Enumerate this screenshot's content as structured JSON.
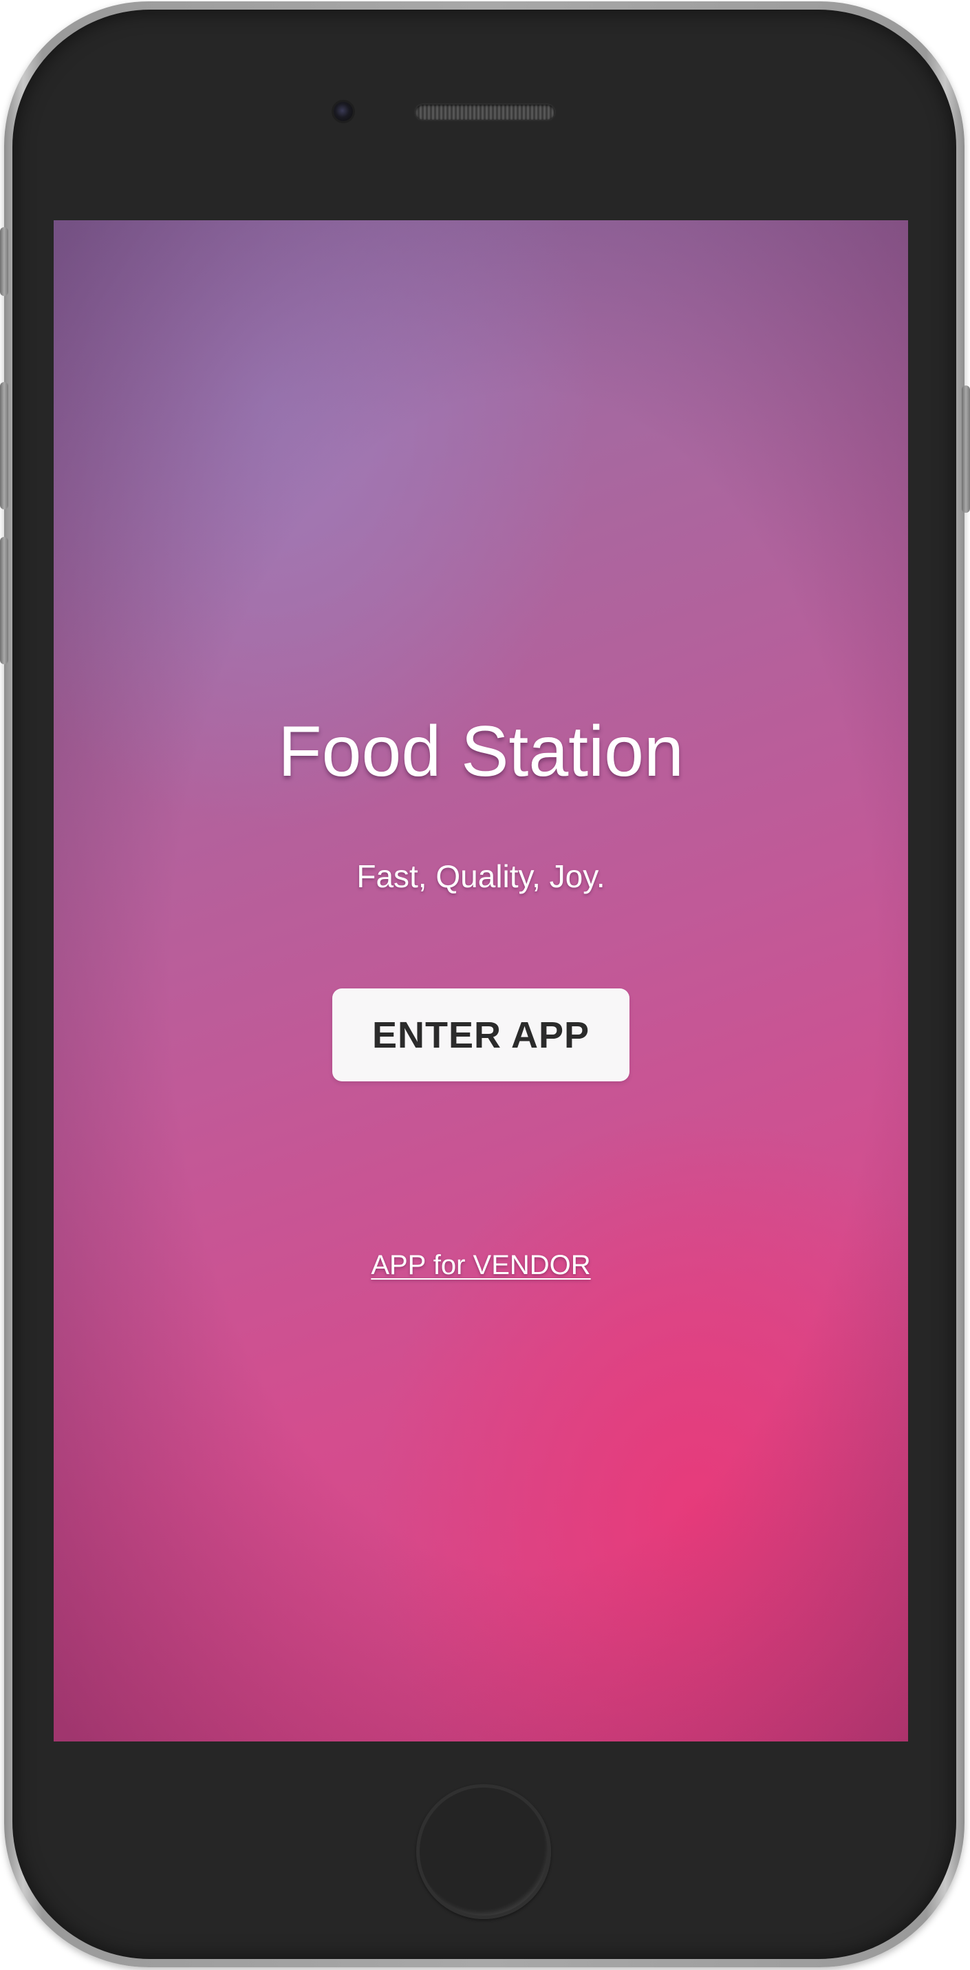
{
  "app": {
    "title": "Food Station",
    "tagline": "Fast, Quality, Joy.",
    "enter_button_label": "ENTER APP",
    "vendor_link_label": "APP for VENDOR"
  },
  "colors": {
    "gradient_top": "#8f6fa6",
    "gradient_bottom": "#d94181",
    "button_bg": "#f8f7f8",
    "button_text": "#2b2b2b",
    "text": "#ffffff",
    "device_frame": "#262626"
  }
}
